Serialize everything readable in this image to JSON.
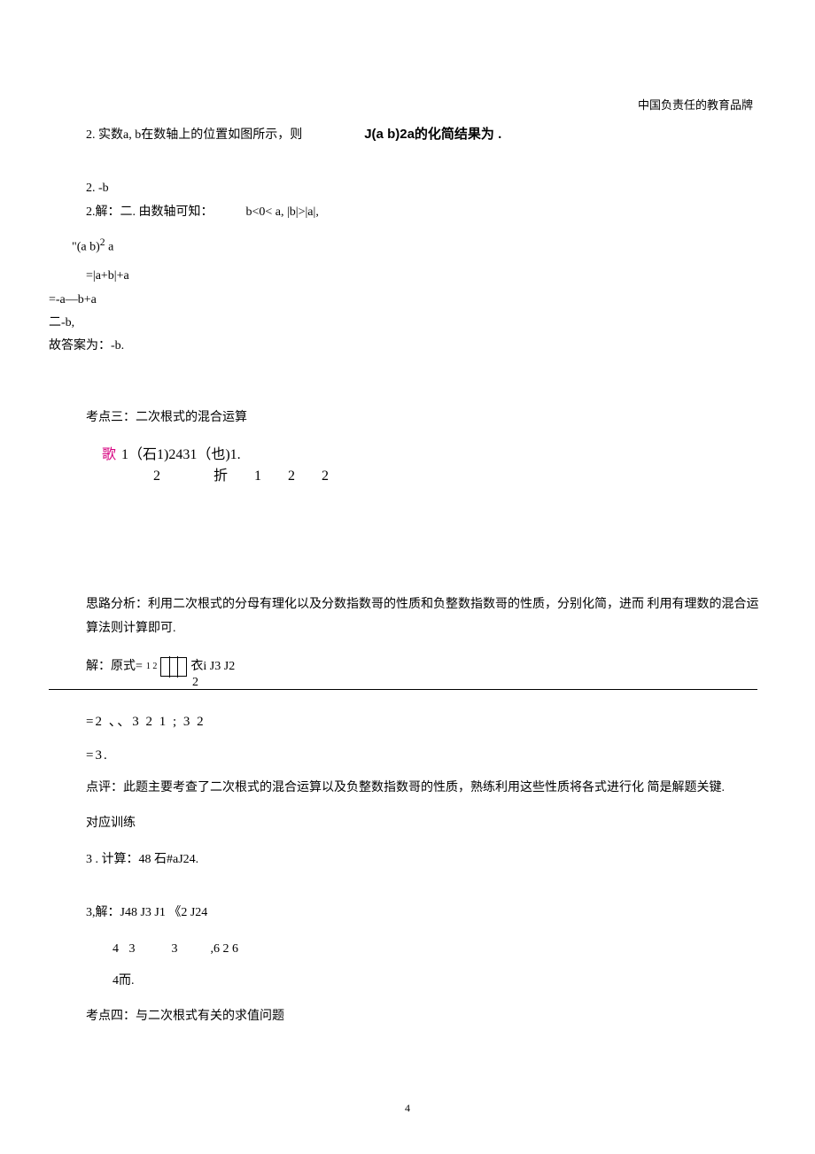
{
  "brand": "中国负责任的教育品牌",
  "q2": {
    "prompt_left": "2. 实数a, b在数轴上的位置如图所示，则",
    "expr": "J(a b)",
    "sup": "2",
    "tail": " a的化简结果为  .",
    "ans_short": "2. -b",
    "sol_open": "2.解：二. 由数轴可知：",
    "sol_cond": "b<0< a, |b|>|a|,",
    "step_sqrt": "\"(a b)",
    "step_sqrt_sup": "2",
    "step_sqrt_tail": " a",
    "step_abs": "=|a+b|+a",
    "step_expand": "=-a—b+a",
    "step_result": "二-b,",
    "final": "故答案为：-b."
  },
  "topic3": {
    "title": "考点三：二次根式的混合运算",
    "ex_row1_pink": "歌",
    "ex_row1_rest": "1（石1)2431（也)1.",
    "ex_row2_a": "2",
    "ex_row2_fold": "折",
    "ex_row2_b": "1",
    "ex_row2_c": "2",
    "ex_row2_d": "2",
    "analysis": "思路分析：利用二次根式的分母有理化以及分数指数哥的性质和负整数指数哥的性质，分别化简，进而 利用有理数的混合运算法则计算即可.",
    "sol_label": "解：原式=",
    "sol_tail": "衣i J3 J2",
    "sol_under": "2",
    "calc1": "=2 、、3     2 1 ;   3        2",
    "calc2": "=3.",
    "comment": "点评：此题主要考查了二次根式的混合运算以及负整数指数哥的性质，熟练利用这些性质将各式进行化 简是解题关键.",
    "train_label": "对应训练",
    "train_q": "3 . 计算：48 石#aJ24.",
    "train_sol_open": "3,解：J48 J3 J1 《2 J24",
    "train_step1_a": "4 3",
    "train_step1_b": "3",
    "train_step1_c": ",6 2 6",
    "train_step2": "4而."
  },
  "topic4": {
    "title": "考点四：与二次根式有关的求值问题"
  },
  "page_number": "4"
}
